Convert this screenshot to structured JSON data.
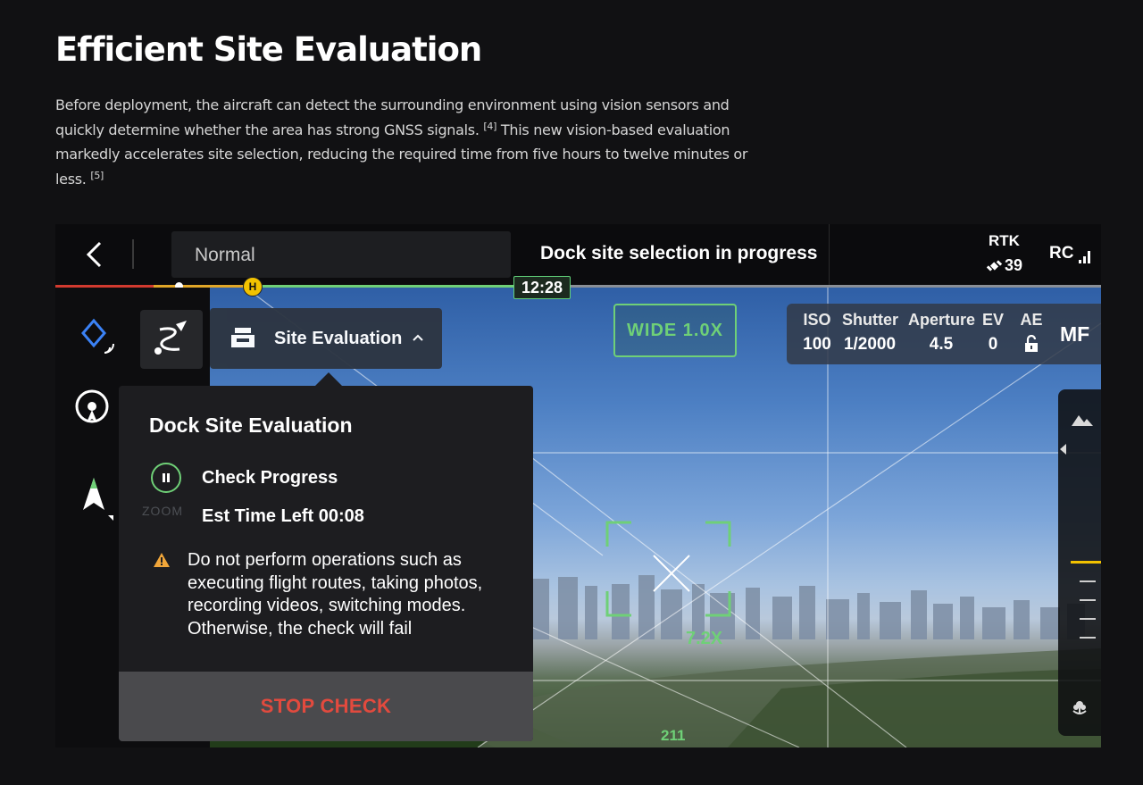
{
  "page": {
    "title": "Efficient Site Evaluation",
    "intro": {
      "part1": "Before deployment, the aircraft can detect the surrounding environment using vision sensors and quickly determine whether the area has strong GNSS signals.",
      "ref1": "[4]",
      "part2": "This new vision-based evaluation markedly accelerates site selection, reducing the required time from five hours to twelve minutes or less.",
      "ref2": "[5]"
    }
  },
  "app": {
    "topbar": {
      "mode": "Normal",
      "status": "Dock site selection in progress",
      "rtk_label": "RTK",
      "satellites": "39",
      "rc_label": "RC"
    },
    "timeline": {
      "time_remaining": "12:28",
      "home_marker": "H"
    },
    "site_evaluation_button": "Site Evaluation",
    "panel": {
      "title": "Dock Site Evaluation",
      "check_progress": "Check Progress",
      "est_time": "Est Time Left 00:08",
      "warning": "Do not perform operations such as executing flight routes, taking photos, recording videos, switching modes. Otherwise, the check will fail",
      "stop_button": "STOP CHECK",
      "ghost_text": "ZOOM"
    },
    "camera": {
      "lens": "WIDE  1.0X",
      "iso_label": "ISO",
      "iso_value": "100",
      "shutter_label": "Shutter",
      "shutter_value": "1/2000",
      "aperture_label": "Aperture",
      "aperture_value": "4.5",
      "ev_label": "EV",
      "ev_value": "0",
      "ae_label": "AE",
      "focus_mode": "MF",
      "zoom_readout": "7.2X",
      "altitude_readout": "211"
    },
    "colors": {
      "accent_green": "#6fd077",
      "stop_red": "#e24a3e",
      "home_yellow": "#f2c200"
    },
    "icons": [
      "chevron-left-icon",
      "satellite-icon",
      "signal-bars-icon",
      "diamond-nav-icon",
      "route-icon",
      "camera-target-icon",
      "compass-icon",
      "dock-icon",
      "chevron-up-icon",
      "pause-icon",
      "warning-icon",
      "lock-open-icon",
      "mountain-icon",
      "flower-icon"
    ]
  }
}
